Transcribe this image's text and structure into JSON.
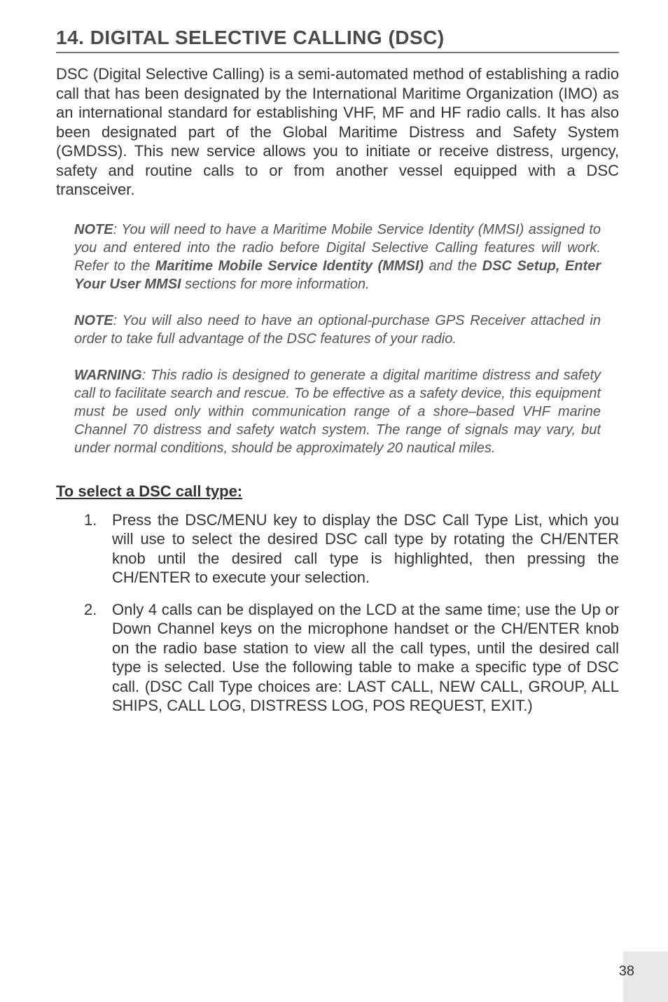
{
  "section_title": "14. DIGITAL SELECTIVE CALLING (DSC)",
  "intro": "DSC (Digital Selective Calling) is a semi-automated method of establishing a radio call that has been designated by the International Maritime Organization (IMO) as an international standard for establishing VHF, MF and HF radio calls. It has also been designated part of the Global Maritime Distress and Safety System (GMDSS). This new service allows you to initiate or receive distress, urgency, safety and routine calls to or from another vessel equipped with a DSC transceiver.",
  "note1": {
    "lead": "NOTE",
    "pre": ": You will need to have a Maritime Mobile Service Identity (MMSI) assigned to you and entered into the radio before Digital Selective Calling features will work. Refer to the ",
    "bold1": "Maritime Mobile Service Identity (MMSI)",
    "mid": " and the ",
    "bold2": "DSC Setup, Enter Your User MMSI",
    "post": " sections for more information."
  },
  "note2": {
    "lead": "NOTE",
    "body": ": You will also need to have an optional-purchase GPS Receiver attached in order to take full advantage of the DSC features of your radio."
  },
  "warning": {
    "lead": "WARNING",
    "body": ": This radio is designed to generate a digital maritime distress and safety call to facilitate search and rescue. To be effective as a safety device, this equipment must be used only within communication range of a shore–based VHF marine Channel 70 distress and safety watch system. The range of signals may vary, but under normal conditions, should be approximately 20 nautical miles."
  },
  "subhead": "To select a DSC call type:",
  "steps": [
    {
      "num": "1.",
      "body": "Press the DSC/MENU key to display the DSC Call Type List, which you will use to select the desired DSC call type by rotating the CH/ENTER knob until the desired call type is highlighted, then pressing the CH/ENTER to execute your selection."
    },
    {
      "num": "2.",
      "body": "Only 4 calls can be displayed on the LCD at the same time; use the Up or Down Channel keys on the microphone handset or the CH/ENTER knob on the radio base station to view all the call types, until the desired call type is selected. Use the following table to make a specific type of DSC call. (DSC Call Type choices are: LAST CALL, NEW CALL, GROUP, ALL SHIPS, CALL LOG, DISTRESS LOG, POS REQUEST, EXIT.)"
    }
  ],
  "page_number": "38"
}
